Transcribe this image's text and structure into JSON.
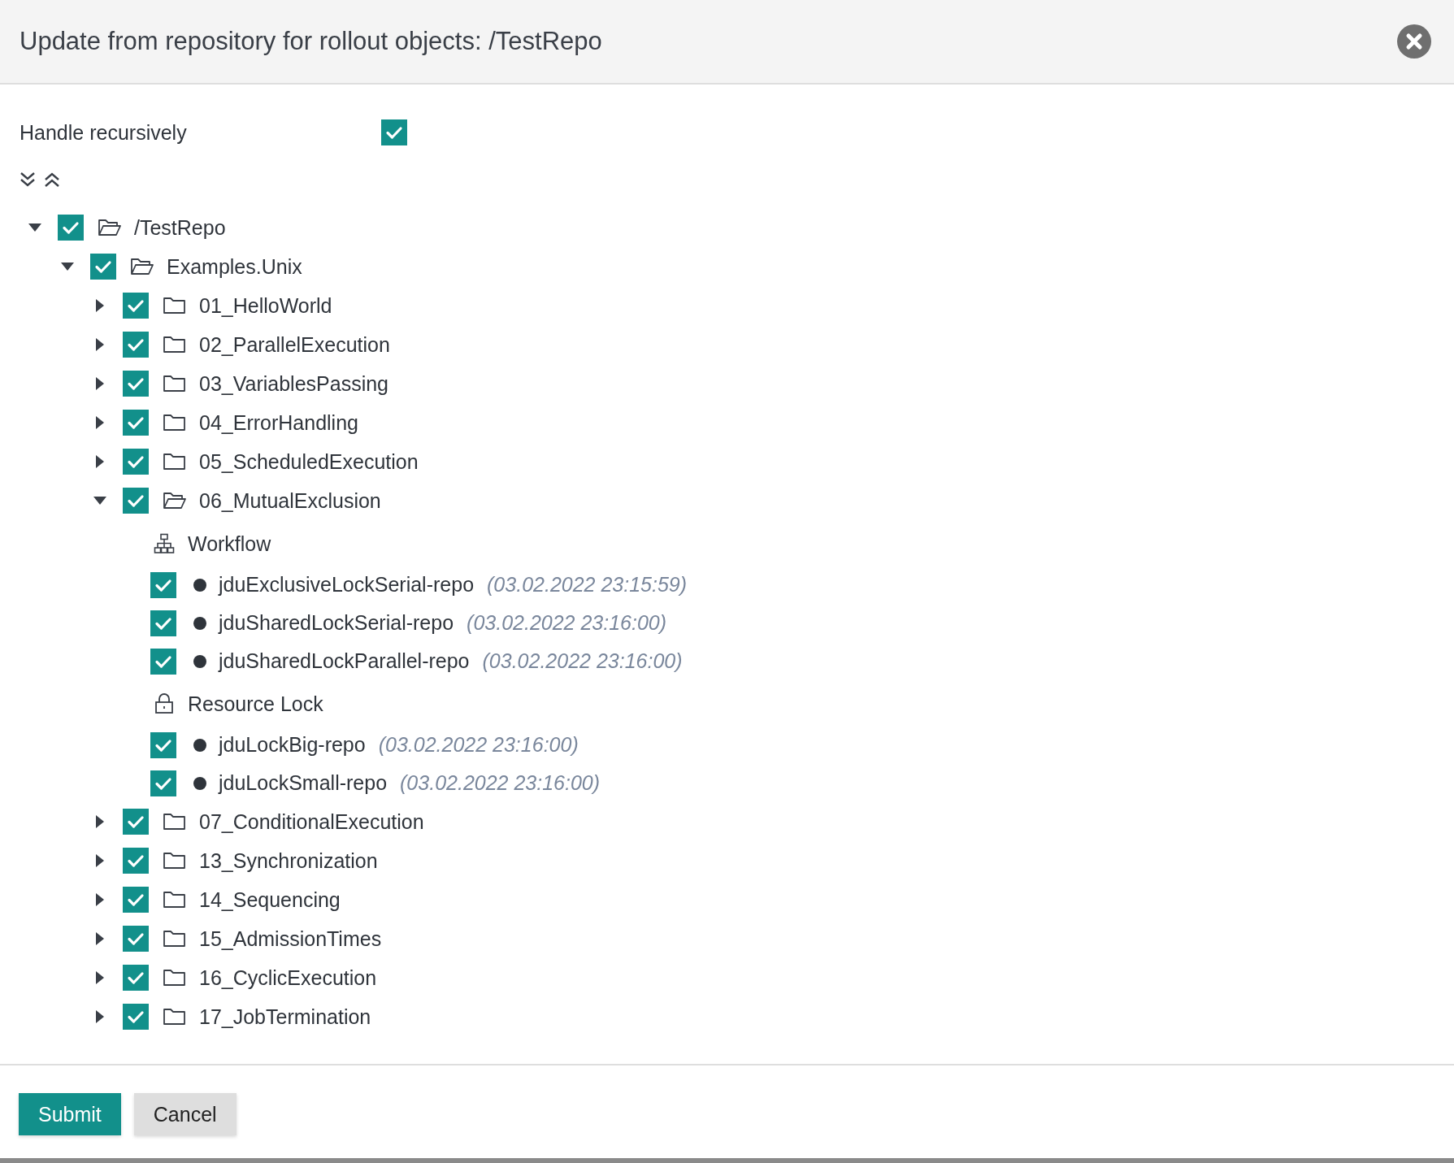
{
  "dialog": {
    "title": "Update from repository for rollout objects: /TestRepo"
  },
  "handle_recursively": {
    "label": "Handle recursively",
    "checked": true
  },
  "tree": [
    {
      "kind": "folder",
      "label": "/TestRepo",
      "checked": true,
      "expanded": true,
      "children": [
        {
          "kind": "folder",
          "label": "Examples.Unix",
          "checked": true,
          "expanded": true,
          "children": [
            {
              "kind": "folder",
              "label": "01_HelloWorld",
              "checked": true,
              "expanded": false
            },
            {
              "kind": "folder",
              "label": "02_ParallelExecution",
              "checked": true,
              "expanded": false
            },
            {
              "kind": "folder",
              "label": "03_VariablesPassing",
              "checked": true,
              "expanded": false
            },
            {
              "kind": "folder",
              "label": "04_ErrorHandling",
              "checked": true,
              "expanded": false
            },
            {
              "kind": "folder",
              "label": "05_ScheduledExecution",
              "checked": true,
              "expanded": false
            },
            {
              "kind": "folder",
              "label": "06_MutualExclusion",
              "checked": true,
              "expanded": true,
              "children": [
                {
                  "kind": "workflow-group",
                  "label": "Workflow"
                },
                {
                  "kind": "item",
                  "label": "jduExclusiveLockSerial-repo",
                  "date": "(03.02.2022 23:15:59)",
                  "checked": true
                },
                {
                  "kind": "item",
                  "label": "jduSharedLockSerial-repo",
                  "date": "(03.02.2022 23:16:00)",
                  "checked": true
                },
                {
                  "kind": "item",
                  "label": "jduSharedLockParallel-repo",
                  "date": "(03.02.2022 23:16:00)",
                  "checked": true
                },
                {
                  "kind": "lock-group",
                  "label": "Resource Lock"
                },
                {
                  "kind": "item",
                  "label": "jduLockBig-repo",
                  "date": "(03.02.2022 23:16:00)",
                  "checked": true
                },
                {
                  "kind": "item",
                  "label": "jduLockSmall-repo",
                  "date": "(03.02.2022 23:16:00)",
                  "checked": true
                }
              ]
            },
            {
              "kind": "folder",
              "label": "07_ConditionalExecution",
              "checked": true,
              "expanded": false
            },
            {
              "kind": "folder",
              "label": "13_Synchronization",
              "checked": true,
              "expanded": false
            },
            {
              "kind": "folder",
              "label": "14_Sequencing",
              "checked": true,
              "expanded": false
            },
            {
              "kind": "folder",
              "label": "15_AdmissionTimes",
              "checked": true,
              "expanded": false
            },
            {
              "kind": "folder",
              "label": "16_CyclicExecution",
              "checked": true,
              "expanded": false
            },
            {
              "kind": "folder",
              "label": "17_JobTermination",
              "checked": true,
              "expanded": false
            }
          ]
        }
      ]
    }
  ],
  "buttons": [
    {
      "kind": "primary",
      "label": "Submit"
    },
    {
      "kind": "secondary",
      "label": "Cancel"
    }
  ]
}
